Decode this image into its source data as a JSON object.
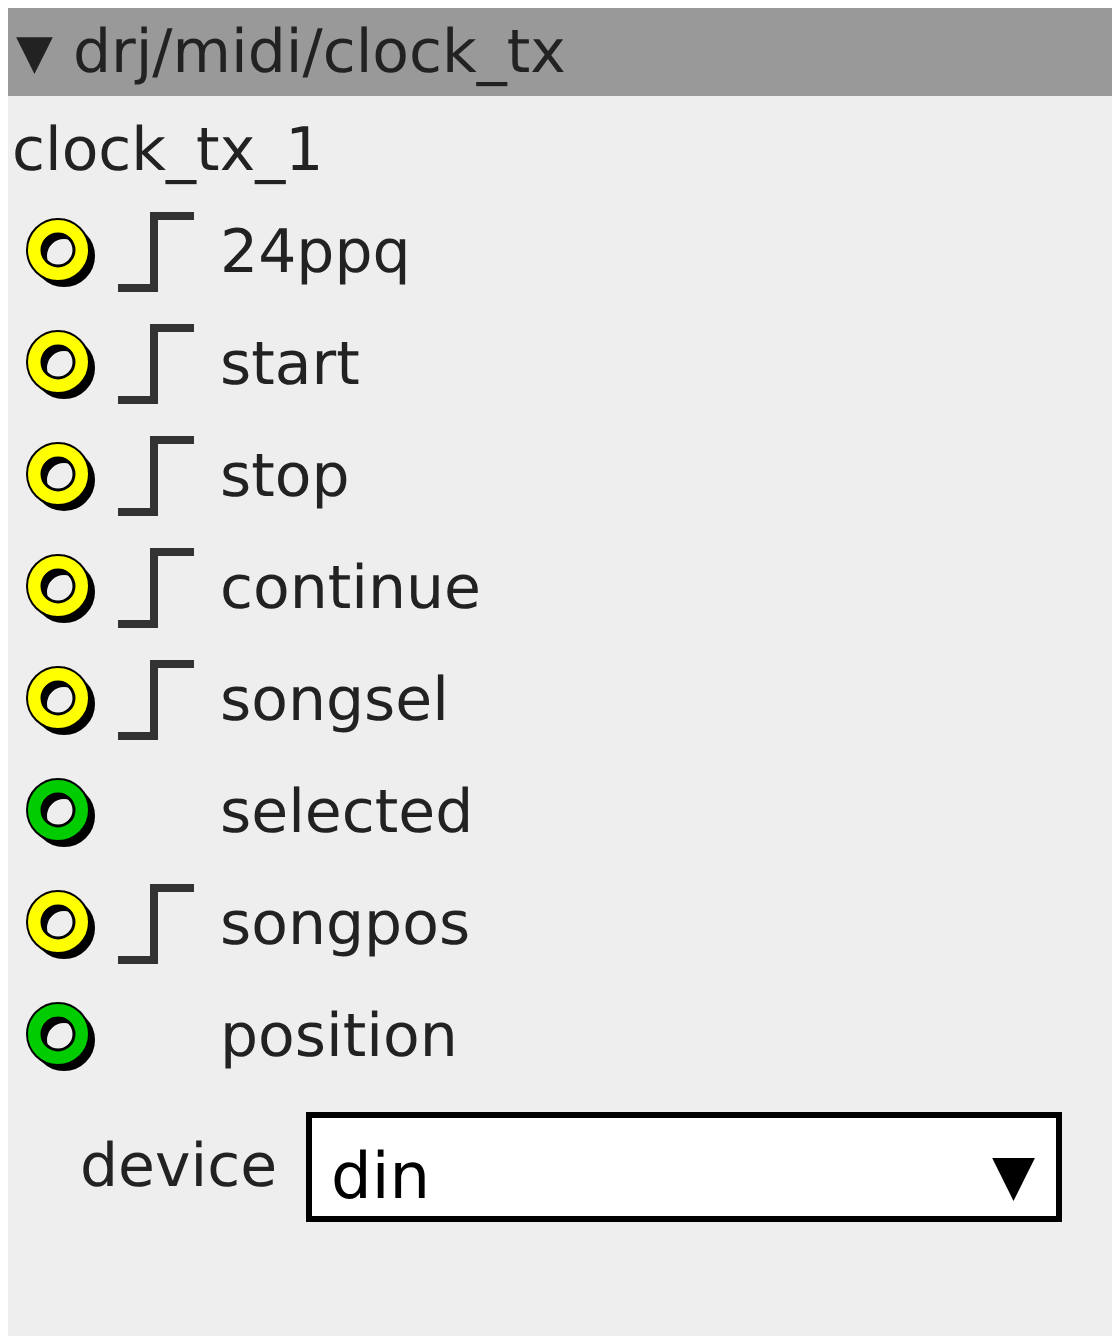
{
  "header": {
    "collapse_glyph": "▼",
    "title": "drj/midi/clock_tx"
  },
  "instance_name": "clock_tx_1",
  "inlets": [
    {
      "label": "24ppq",
      "kind": "trigger",
      "color": "#ffff00"
    },
    {
      "label": "start",
      "kind": "trigger",
      "color": "#ffff00"
    },
    {
      "label": "stop",
      "kind": "trigger",
      "color": "#ffff00"
    },
    {
      "label": "continue",
      "kind": "trigger",
      "color": "#ffff00"
    },
    {
      "label": "songsel",
      "kind": "trigger",
      "color": "#ffff00"
    },
    {
      "label": "selected",
      "kind": "value",
      "color": "#00cc00"
    },
    {
      "label": "songpos",
      "kind": "trigger",
      "color": "#ffff00"
    },
    {
      "label": "position",
      "kind": "value",
      "color": "#00cc00"
    }
  ],
  "attribute": {
    "label": "device",
    "value": "din",
    "arrow": "▼"
  }
}
